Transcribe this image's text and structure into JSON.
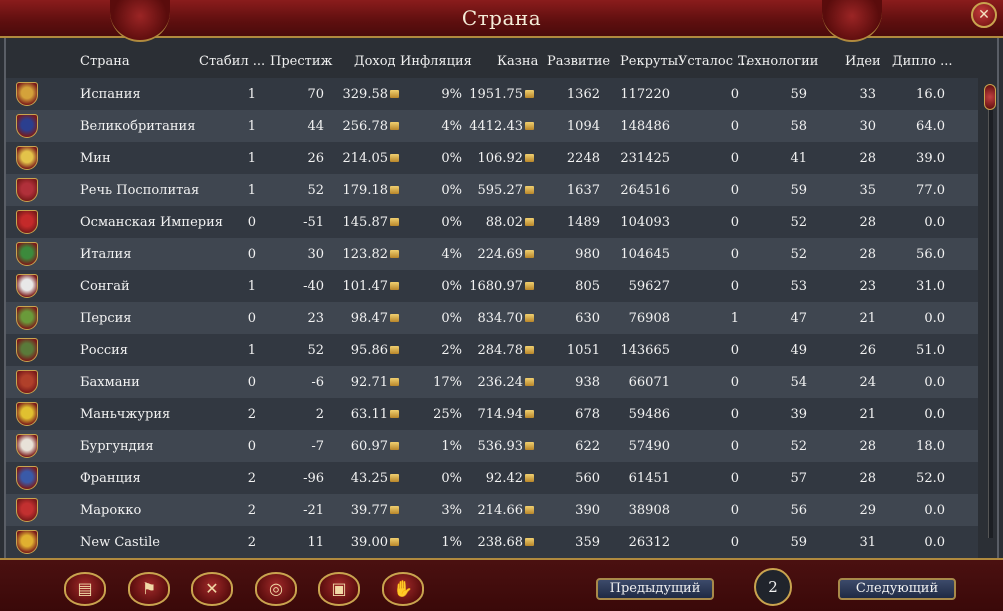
{
  "window": {
    "title": "Страна",
    "close_label": "✕"
  },
  "columns": {
    "name": "Страна",
    "stability": "Стабил ...",
    "prestige": "Престиж",
    "income": "Доход",
    "inflation": "Инфляция",
    "treasury": "Казна",
    "development": "Развитие",
    "manpower": "Рекруты",
    "war_exhaustion": "Усталос ...",
    "technology": "Технологии",
    "ideas": "Идеи",
    "diplo": "Дипло ..."
  },
  "rows": [
    {
      "name": "Испания",
      "stab": "1",
      "pres": "70",
      "inc": "329.58",
      "infl": "9%",
      "trea": "1951.75",
      "dev": "1362",
      "man": "117220",
      "war": "0",
      "tech": "59",
      "idea": "33",
      "dip": "16.0",
      "flag": "#d4a23a"
    },
    {
      "name": "Великобритания",
      "stab": "1",
      "pres": "44",
      "inc": "256.78",
      "infl": "4%",
      "trea": "4412.43",
      "dev": "1094",
      "man": "148486",
      "war": "0",
      "tech": "58",
      "idea": "30",
      "dip": "64.0",
      "flag": "#2b3f8f"
    },
    {
      "name": "Мин",
      "stab": "1",
      "pres": "26",
      "inc": "214.05",
      "infl": "0%",
      "trea": "106.92",
      "dev": "2248",
      "man": "231425",
      "war": "0",
      "tech": "41",
      "idea": "28",
      "dip": "39.0",
      "flag": "#e3c34a"
    },
    {
      "name": "Речь Посполитая",
      "stab": "1",
      "pres": "52",
      "inc": "179.18",
      "infl": "0%",
      "trea": "595.27",
      "dev": "1637",
      "man": "264516",
      "war": "0",
      "tech": "59",
      "idea": "35",
      "dip": "77.0",
      "flag": "#b0303a"
    },
    {
      "name": "Османская Империя",
      "stab": "0",
      "pres": "-51",
      "inc": "145.87",
      "infl": "0%",
      "trea": "88.02",
      "dev": "1489",
      "man": "104093",
      "war": "0",
      "tech": "52",
      "idea": "28",
      "dip": "0.0",
      "flag": "#c42a2a"
    },
    {
      "name": "Италия",
      "stab": "0",
      "pres": "30",
      "inc": "123.82",
      "infl": "4%",
      "trea": "224.69",
      "dev": "980",
      "man": "104645",
      "war": "0",
      "tech": "52",
      "idea": "28",
      "dip": "56.0",
      "flag": "#3c8a3c"
    },
    {
      "name": "Сонгай",
      "stab": "1",
      "pres": "-40",
      "inc": "101.47",
      "infl": "0%",
      "trea": "1680.97",
      "dev": "805",
      "man": "59627",
      "war": "0",
      "tech": "53",
      "idea": "23",
      "dip": "31.0",
      "flag": "#e8e8e8"
    },
    {
      "name": "Персия",
      "stab": "0",
      "pres": "23",
      "inc": "98.47",
      "infl": "0%",
      "trea": "834.70",
      "dev": "630",
      "man": "76908",
      "war": "1",
      "tech": "47",
      "idea": "21",
      "dip": "0.0",
      "flag": "#6a9a3a"
    },
    {
      "name": "Россия",
      "stab": "1",
      "pres": "52",
      "inc": "95.86",
      "infl": "2%",
      "trea": "284.78",
      "dev": "1051",
      "man": "143665",
      "war": "0",
      "tech": "49",
      "idea": "26",
      "dip": "51.0",
      "flag": "#5a7a3a"
    },
    {
      "name": "Бахмани",
      "stab": "0",
      "pres": "-6",
      "inc": "92.71",
      "infl": "17%",
      "trea": "236.24",
      "dev": "938",
      "man": "66071",
      "war": "0",
      "tech": "54",
      "idea": "24",
      "dip": "0.0",
      "flag": "#b0402a"
    },
    {
      "name": "Маньчжурия",
      "stab": "2",
      "pres": "2",
      "inc": "63.11",
      "infl": "25%",
      "trea": "714.94",
      "dev": "678",
      "man": "59486",
      "war": "0",
      "tech": "39",
      "idea": "21",
      "dip": "0.0",
      "flag": "#e0c030"
    },
    {
      "name": "Бургундия",
      "stab": "0",
      "pres": "-7",
      "inc": "60.97",
      "infl": "1%",
      "trea": "536.93",
      "dev": "622",
      "man": "57490",
      "war": "0",
      "tech": "52",
      "idea": "28",
      "dip": "18.0",
      "flag": "#e8e2d8"
    },
    {
      "name": "Франция",
      "stab": "2",
      "pres": "-96",
      "inc": "43.25",
      "infl": "0%",
      "trea": "92.42",
      "dev": "560",
      "man": "61451",
      "war": "0",
      "tech": "57",
      "idea": "28",
      "dip": "52.0",
      "flag": "#3a5aa8"
    },
    {
      "name": "Марокко",
      "stab": "2",
      "pres": "-21",
      "inc": "39.77",
      "infl": "3%",
      "trea": "214.66",
      "dev": "390",
      "man": "38908",
      "war": "0",
      "tech": "56",
      "idea": "29",
      "dip": "0.0",
      "flag": "#c23030"
    },
    {
      "name": "New Castile",
      "stab": "2",
      "pres": "11",
      "inc": "39.00",
      "infl": "1%",
      "trea": "238.68",
      "dev": "359",
      "man": "26312",
      "war": "0",
      "tech": "59",
      "idea": "31",
      "dip": "0.0",
      "flag": "#e0b030"
    }
  ],
  "toolbar": {
    "buttons": [
      {
        "icon": "ledger-icon",
        "glyph": "▤"
      },
      {
        "icon": "flag-icon",
        "glyph": "⚑"
      },
      {
        "icon": "crossed-swords-icon",
        "glyph": "✕"
      },
      {
        "icon": "coins-icon",
        "glyph": "◎"
      },
      {
        "icon": "trade-goods-icon",
        "glyph": "▣"
      },
      {
        "icon": "handshake-icon",
        "glyph": "✋"
      }
    ]
  },
  "pagination": {
    "prev_label": "Предыдущий",
    "page": "2",
    "next_label": "Следующий"
  }
}
